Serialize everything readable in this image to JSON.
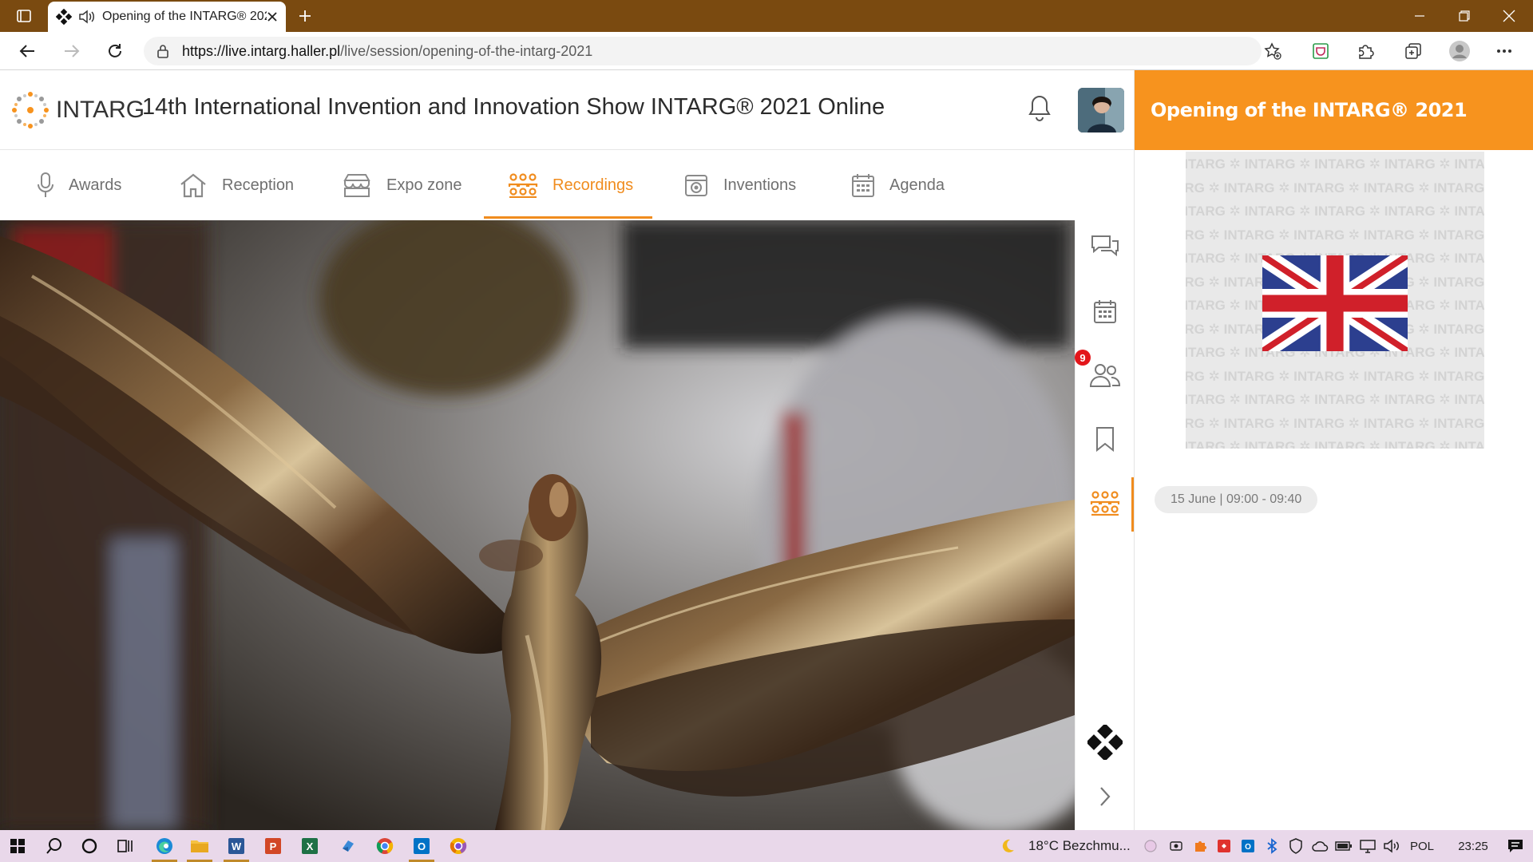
{
  "browser": {
    "tab_title": "Opening of the INTARG® 2021",
    "url_host": "https://live.intarg.haller.pl",
    "url_path": "/live/session/opening-of-the-intarg-2021"
  },
  "header": {
    "logo_text": "INTARG",
    "event_title": "14th International Invention and Innovation Show INTARG® 2021 Online"
  },
  "nav": {
    "tabs": [
      {
        "label": "Awards",
        "icon": "microphone-icon"
      },
      {
        "label": "Reception",
        "icon": "home-icon"
      },
      {
        "label": "Expo zone",
        "icon": "booth-icon"
      },
      {
        "label": "Recordings",
        "icon": "audience-icon",
        "active": true
      },
      {
        "label": "Inventions",
        "icon": "box-icon"
      },
      {
        "label": "Agenda",
        "icon": "calendar-icon"
      }
    ]
  },
  "rail": {
    "participants_badge": "9"
  },
  "session": {
    "title": "Opening of the INTARG® 2021",
    "watermark": "INTARG",
    "time": "15 June | 09:00 - 09:40"
  },
  "taskbar": {
    "weather": "18°C  Bezchmu...",
    "language": "POL",
    "clock": "23:25"
  },
  "colors": {
    "accent": "#f7931e",
    "tab_bar": "#7a4a10",
    "badge": "#e3161b"
  }
}
